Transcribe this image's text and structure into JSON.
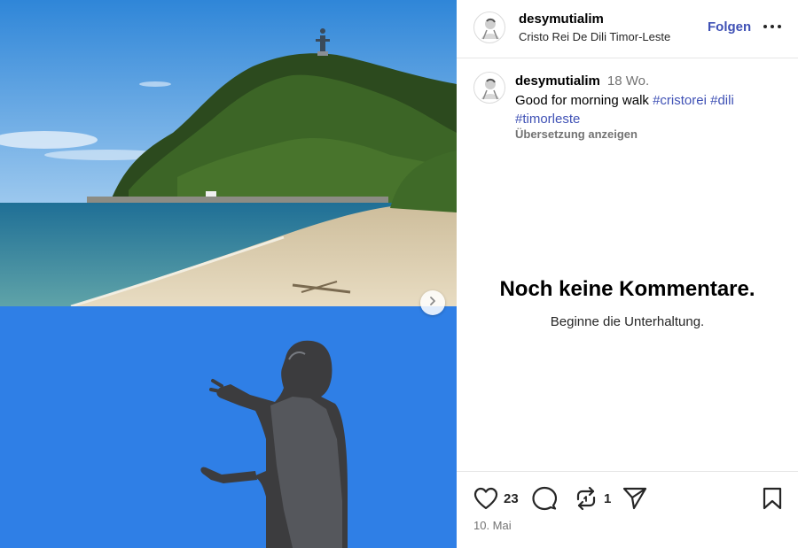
{
  "post": {
    "username": "desymutialim",
    "location": "Cristo Rei De Dili Timor-Leste",
    "follow_label": "Folgen",
    "caption": {
      "username": "desymutialim",
      "time_ago": "18 Wo.",
      "text": "Good for morning walk",
      "hashtags": [
        "#cristorei",
        "#dili",
        "#timorleste"
      ],
      "translate_label": "Übersetzung anzeigen"
    },
    "comments": {
      "empty_title": "Noch keine Kommentare.",
      "empty_subtitle": "Beginne die Unterhaltung."
    },
    "actions": {
      "like_count": "23",
      "repost_count": "1",
      "date": "10. Mai"
    }
  },
  "icons": {
    "more": "more-horizontal-icon",
    "next": "chevron-right-icon",
    "like": "heart-icon",
    "comment": "comment-bubble-icon",
    "repost": "repost-icon",
    "share": "share-plane-icon",
    "save": "bookmark-icon"
  },
  "colors": {
    "accent": "#3f51b5",
    "muted": "#737373",
    "divider": "#e6e6e6"
  }
}
